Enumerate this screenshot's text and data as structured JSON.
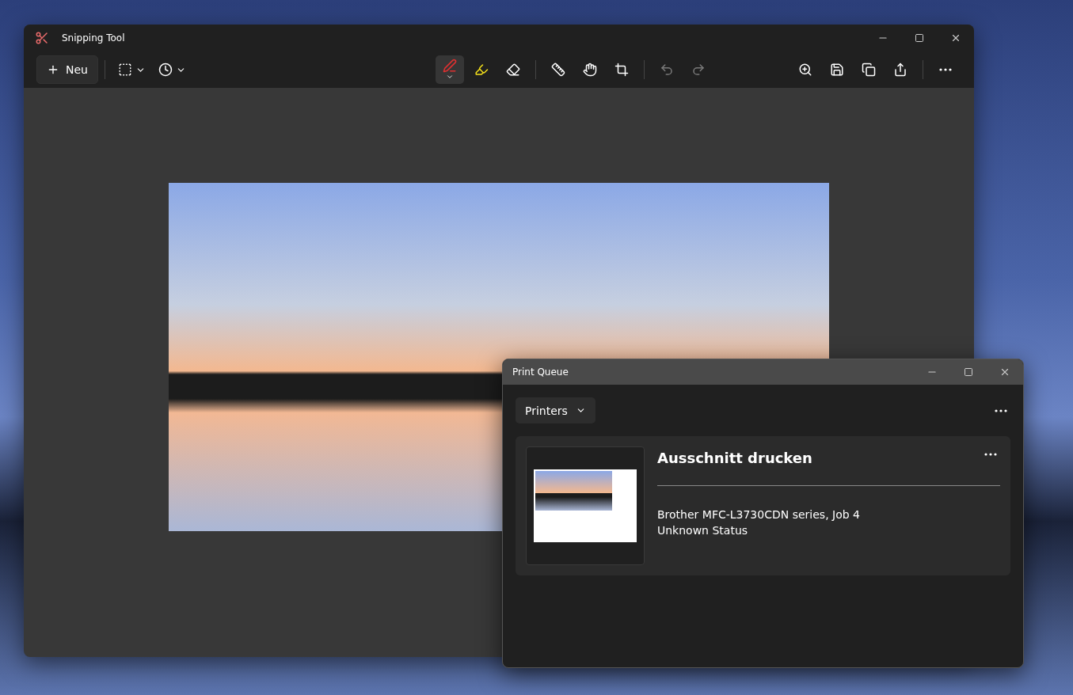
{
  "snipping_tool": {
    "title": "Snipping Tool",
    "new_button": "Neu",
    "mode_tools": [
      {
        "kind": "rectangle"
      },
      {
        "kind": "timer"
      }
    ],
    "tool_groups": [
      {
        "tools": [
          {
            "kind": "pen",
            "selected": true
          },
          {
            "kind": "highlighter",
            "selected": false
          },
          {
            "kind": "eraser",
            "selected": false
          }
        ]
      },
      {
        "tools": [
          {
            "kind": "ruler",
            "selected": false
          },
          {
            "kind": "touch",
            "selected": false
          },
          {
            "kind": "crop",
            "selected": false
          }
        ]
      },
      {
        "tools": [
          {
            "kind": "undo",
            "selected": false,
            "disabled": true
          },
          {
            "kind": "redo",
            "selected": false,
            "disabled": true
          }
        ]
      }
    ],
    "actions": [
      {
        "kind": "zoom"
      },
      {
        "kind": "save"
      },
      {
        "kind": "copy"
      },
      {
        "kind": "share"
      }
    ]
  },
  "print_queue": {
    "title": "Print Queue",
    "printers_button": "Printers",
    "jobs": [
      {
        "title": "Ausschnitt drucken",
        "printer": "Brother MFC-L3730CDN series, Job 4",
        "status": "Unknown Status"
      }
    ]
  }
}
